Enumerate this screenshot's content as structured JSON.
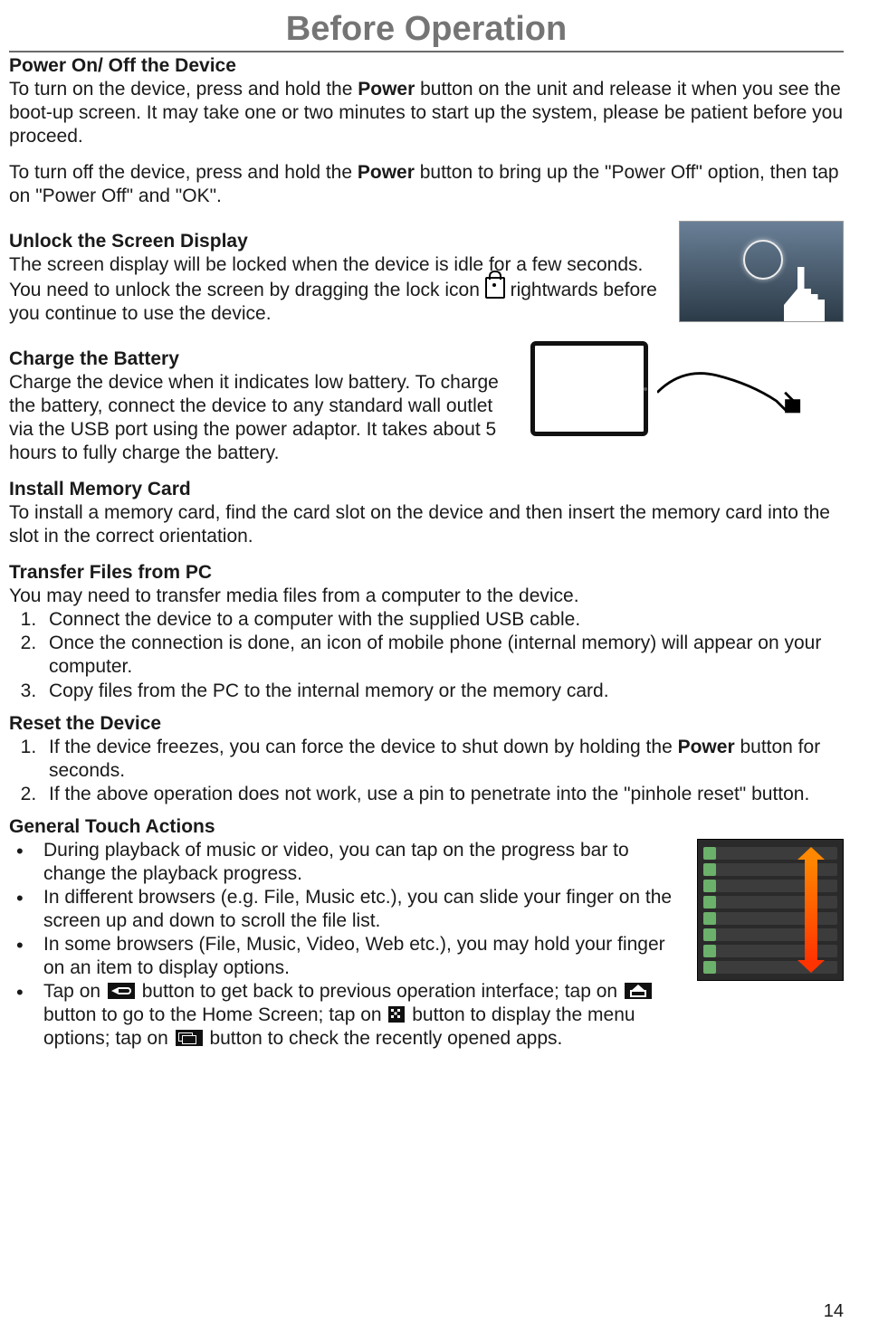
{
  "title": "Before Operation",
  "page_number": "14",
  "power": {
    "heading": "Power On/ Off the Device",
    "p1a": "To turn on the device, press and hold the ",
    "p1b": "Power",
    "p1c": " button on the unit and release it when you see the boot-up screen. It may take one or two minutes to start up the system, please be patient before you proceed.",
    "p2a": "To turn off the device, press and hold the ",
    "p2b": "Power",
    "p2c": " button to bring up the \"Power Off\" option, then tap on \"Power Off\" and \"OK\"."
  },
  "unlock": {
    "heading": "Unlock the Screen Display",
    "body_before": "The screen display will be locked when the device is idle for a few seconds. You need to unlock the screen by dragging the lock icon ",
    "body_after": " rightwards before you continue to use the device."
  },
  "charge": {
    "heading": "Charge the Battery",
    "body": "Charge the device when it indicates low battery. To charge the battery, connect the device to any standard wall outlet via the USB port using the power adaptor. It takes about 5 hours to fully charge the battery."
  },
  "memory": {
    "heading": "Install Memory Card",
    "body": "To install a memory card, find the card slot on the device and then insert the memory card into the slot in the correct orientation."
  },
  "transfer": {
    "heading": "Transfer Files from PC",
    "intro": "You may need to transfer media files from a computer to the device.",
    "items": [
      "Connect the device to a computer with the supplied USB cable.",
      "Once the connection is done, an icon of mobile phone (internal memory) will appear on your computer.",
      "Copy files from the PC to the internal memory or the memory card."
    ]
  },
  "reset": {
    "heading": "Reset the Device",
    "item1a": "If the device freezes, you can force the device to shut down by holding the ",
    "item1b": "Power",
    "item1c": " button for seconds.",
    "item2": "If the above operation does not work, use a pin to penetrate into the \"pinhole reset\" button."
  },
  "touch": {
    "heading": "General Touch Actions",
    "b1": "During playback of music or video, you can tap on the progress bar to change the playback progress.",
    "b2": "In different browsers (e.g. File, Music etc.), you can slide your finger on the screen up and down to scroll the file list.",
    "b3": "In some browsers (File, Music, Video, Web etc.), you may hold your finger on an item to display options.",
    "b4_1": "Tap on ",
    "b4_2": " button to get back to previous operation interface; tap on ",
    "b4_3": " button to go to the Home Screen; tap on ",
    "b4_4": " button to display the menu options; tap on ",
    "b4_5": " button to check the recently opened apps."
  }
}
